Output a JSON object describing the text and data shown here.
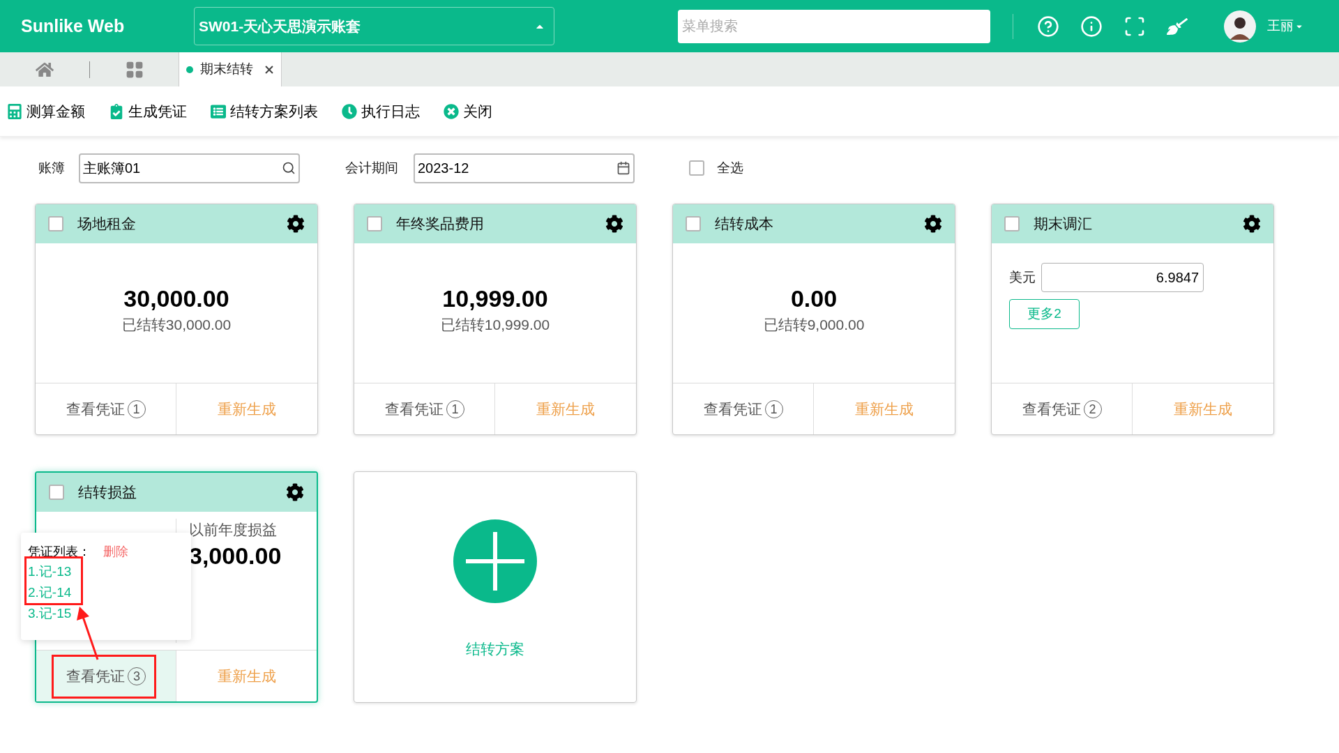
{
  "header": {
    "logo": "Sunlike Web",
    "account_set": "SW01-天心天思演示账套",
    "search": {
      "placeholder": "菜单搜索"
    },
    "user": "王丽"
  },
  "tabs": [
    {
      "label": "期末结转",
      "selected": true
    }
  ],
  "toolbar": [
    "测算金额",
    "生成凭证",
    "结转方案列表",
    "执行日志",
    "关闭"
  ],
  "filters": {
    "ledger": {
      "label": "账簿",
      "value": "主账簿01"
    },
    "period": {
      "label": "会计期间",
      "value": "2023-12"
    },
    "select_all": {
      "label": "全选",
      "checked": false
    }
  },
  "cards": [
    {
      "kind": "amount",
      "title": "场地租金",
      "checked": false,
      "highlighted": false,
      "amount": "30,000.00",
      "carried": "已结转30,000.00",
      "view_label": "查看凭证",
      "voucher_count": "1",
      "regenerate": "重新生成"
    },
    {
      "kind": "amount",
      "title": "年终奖品费用",
      "checked": false,
      "highlighted": false,
      "amount": "10,999.00",
      "carried": "已结转10,999.00",
      "view_label": "查看凭证",
      "voucher_count": "1",
      "regenerate": "重新生成"
    },
    {
      "kind": "amount",
      "title": "结转成本",
      "checked": false,
      "highlighted": false,
      "amount": "0.00",
      "carried": "已结转9,000.00",
      "view_label": "查看凭证",
      "voucher_count": "1",
      "regenerate": "重新生成"
    },
    {
      "kind": "rate",
      "title": "期末调汇",
      "checked": false,
      "highlighted": false,
      "currency": "美元",
      "rate": "6.9847",
      "more": "更多2",
      "view_label": "查看凭证",
      "voucher_count": "2",
      "regenerate": "重新生成"
    },
    {
      "kind": "split",
      "title": "结转损益",
      "checked": false,
      "highlighted": true,
      "column_2": {
        "label": "以前年度损益",
        "value": "3,000.00"
      },
      "view_label": "查看凭证",
      "voucher_count": "3",
      "regenerate": "重新生成",
      "popup": {
        "title": "凭证列表：",
        "delete": "删除",
        "vouchers": [
          "1.记-13",
          "2.记-14",
          "3.记-15"
        ]
      }
    }
  ],
  "add_card": {
    "label": "结转方案"
  }
}
